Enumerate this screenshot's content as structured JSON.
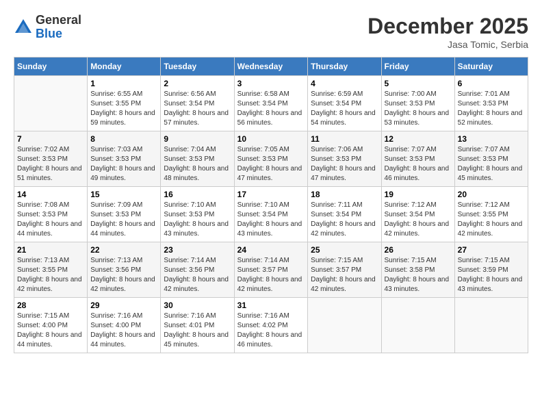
{
  "header": {
    "logo_general": "General",
    "logo_blue": "Blue",
    "month": "December 2025",
    "location": "Jasa Tomic, Serbia"
  },
  "days_of_week": [
    "Sunday",
    "Monday",
    "Tuesday",
    "Wednesday",
    "Thursday",
    "Friday",
    "Saturday"
  ],
  "weeks": [
    [
      {
        "day": "",
        "empty": true
      },
      {
        "day": "1",
        "sunrise": "6:55 AM",
        "sunset": "3:55 PM",
        "daylight": "8 hours and 59 minutes."
      },
      {
        "day": "2",
        "sunrise": "6:56 AM",
        "sunset": "3:54 PM",
        "daylight": "8 hours and 57 minutes."
      },
      {
        "day": "3",
        "sunrise": "6:58 AM",
        "sunset": "3:54 PM",
        "daylight": "8 hours and 56 minutes."
      },
      {
        "day": "4",
        "sunrise": "6:59 AM",
        "sunset": "3:54 PM",
        "daylight": "8 hours and 54 minutes."
      },
      {
        "day": "5",
        "sunrise": "7:00 AM",
        "sunset": "3:53 PM",
        "daylight": "8 hours and 53 minutes."
      },
      {
        "day": "6",
        "sunrise": "7:01 AM",
        "sunset": "3:53 PM",
        "daylight": "8 hours and 52 minutes."
      }
    ],
    [
      {
        "day": "7",
        "sunrise": "7:02 AM",
        "sunset": "3:53 PM",
        "daylight": "8 hours and 51 minutes."
      },
      {
        "day": "8",
        "sunrise": "7:03 AM",
        "sunset": "3:53 PM",
        "daylight": "8 hours and 49 minutes."
      },
      {
        "day": "9",
        "sunrise": "7:04 AM",
        "sunset": "3:53 PM",
        "daylight": "8 hours and 48 minutes."
      },
      {
        "day": "10",
        "sunrise": "7:05 AM",
        "sunset": "3:53 PM",
        "daylight": "8 hours and 47 minutes."
      },
      {
        "day": "11",
        "sunrise": "7:06 AM",
        "sunset": "3:53 PM",
        "daylight": "8 hours and 47 minutes."
      },
      {
        "day": "12",
        "sunrise": "7:07 AM",
        "sunset": "3:53 PM",
        "daylight": "8 hours and 46 minutes."
      },
      {
        "day": "13",
        "sunrise": "7:07 AM",
        "sunset": "3:53 PM",
        "daylight": "8 hours and 45 minutes."
      }
    ],
    [
      {
        "day": "14",
        "sunrise": "7:08 AM",
        "sunset": "3:53 PM",
        "daylight": "8 hours and 44 minutes."
      },
      {
        "day": "15",
        "sunrise": "7:09 AM",
        "sunset": "3:53 PM",
        "daylight": "8 hours and 44 minutes."
      },
      {
        "day": "16",
        "sunrise": "7:10 AM",
        "sunset": "3:53 PM",
        "daylight": "8 hours and 43 minutes."
      },
      {
        "day": "17",
        "sunrise": "7:10 AM",
        "sunset": "3:54 PM",
        "daylight": "8 hours and 43 minutes."
      },
      {
        "day": "18",
        "sunrise": "7:11 AM",
        "sunset": "3:54 PM",
        "daylight": "8 hours and 42 minutes."
      },
      {
        "day": "19",
        "sunrise": "7:12 AM",
        "sunset": "3:54 PM",
        "daylight": "8 hours and 42 minutes."
      },
      {
        "day": "20",
        "sunrise": "7:12 AM",
        "sunset": "3:55 PM",
        "daylight": "8 hours and 42 minutes."
      }
    ],
    [
      {
        "day": "21",
        "sunrise": "7:13 AM",
        "sunset": "3:55 PM",
        "daylight": "8 hours and 42 minutes."
      },
      {
        "day": "22",
        "sunrise": "7:13 AM",
        "sunset": "3:56 PM",
        "daylight": "8 hours and 42 minutes."
      },
      {
        "day": "23",
        "sunrise": "7:14 AM",
        "sunset": "3:56 PM",
        "daylight": "8 hours and 42 minutes."
      },
      {
        "day": "24",
        "sunrise": "7:14 AM",
        "sunset": "3:57 PM",
        "daylight": "8 hours and 42 minutes."
      },
      {
        "day": "25",
        "sunrise": "7:15 AM",
        "sunset": "3:57 PM",
        "daylight": "8 hours and 42 minutes."
      },
      {
        "day": "26",
        "sunrise": "7:15 AM",
        "sunset": "3:58 PM",
        "daylight": "8 hours and 43 minutes."
      },
      {
        "day": "27",
        "sunrise": "7:15 AM",
        "sunset": "3:59 PM",
        "daylight": "8 hours and 43 minutes."
      }
    ],
    [
      {
        "day": "28",
        "sunrise": "7:15 AM",
        "sunset": "4:00 PM",
        "daylight": "8 hours and 44 minutes."
      },
      {
        "day": "29",
        "sunrise": "7:16 AM",
        "sunset": "4:00 PM",
        "daylight": "8 hours and 44 minutes."
      },
      {
        "day": "30",
        "sunrise": "7:16 AM",
        "sunset": "4:01 PM",
        "daylight": "8 hours and 45 minutes."
      },
      {
        "day": "31",
        "sunrise": "7:16 AM",
        "sunset": "4:02 PM",
        "daylight": "8 hours and 46 minutes."
      },
      {
        "day": "",
        "empty": true
      },
      {
        "day": "",
        "empty": true
      },
      {
        "day": "",
        "empty": true
      }
    ]
  ]
}
